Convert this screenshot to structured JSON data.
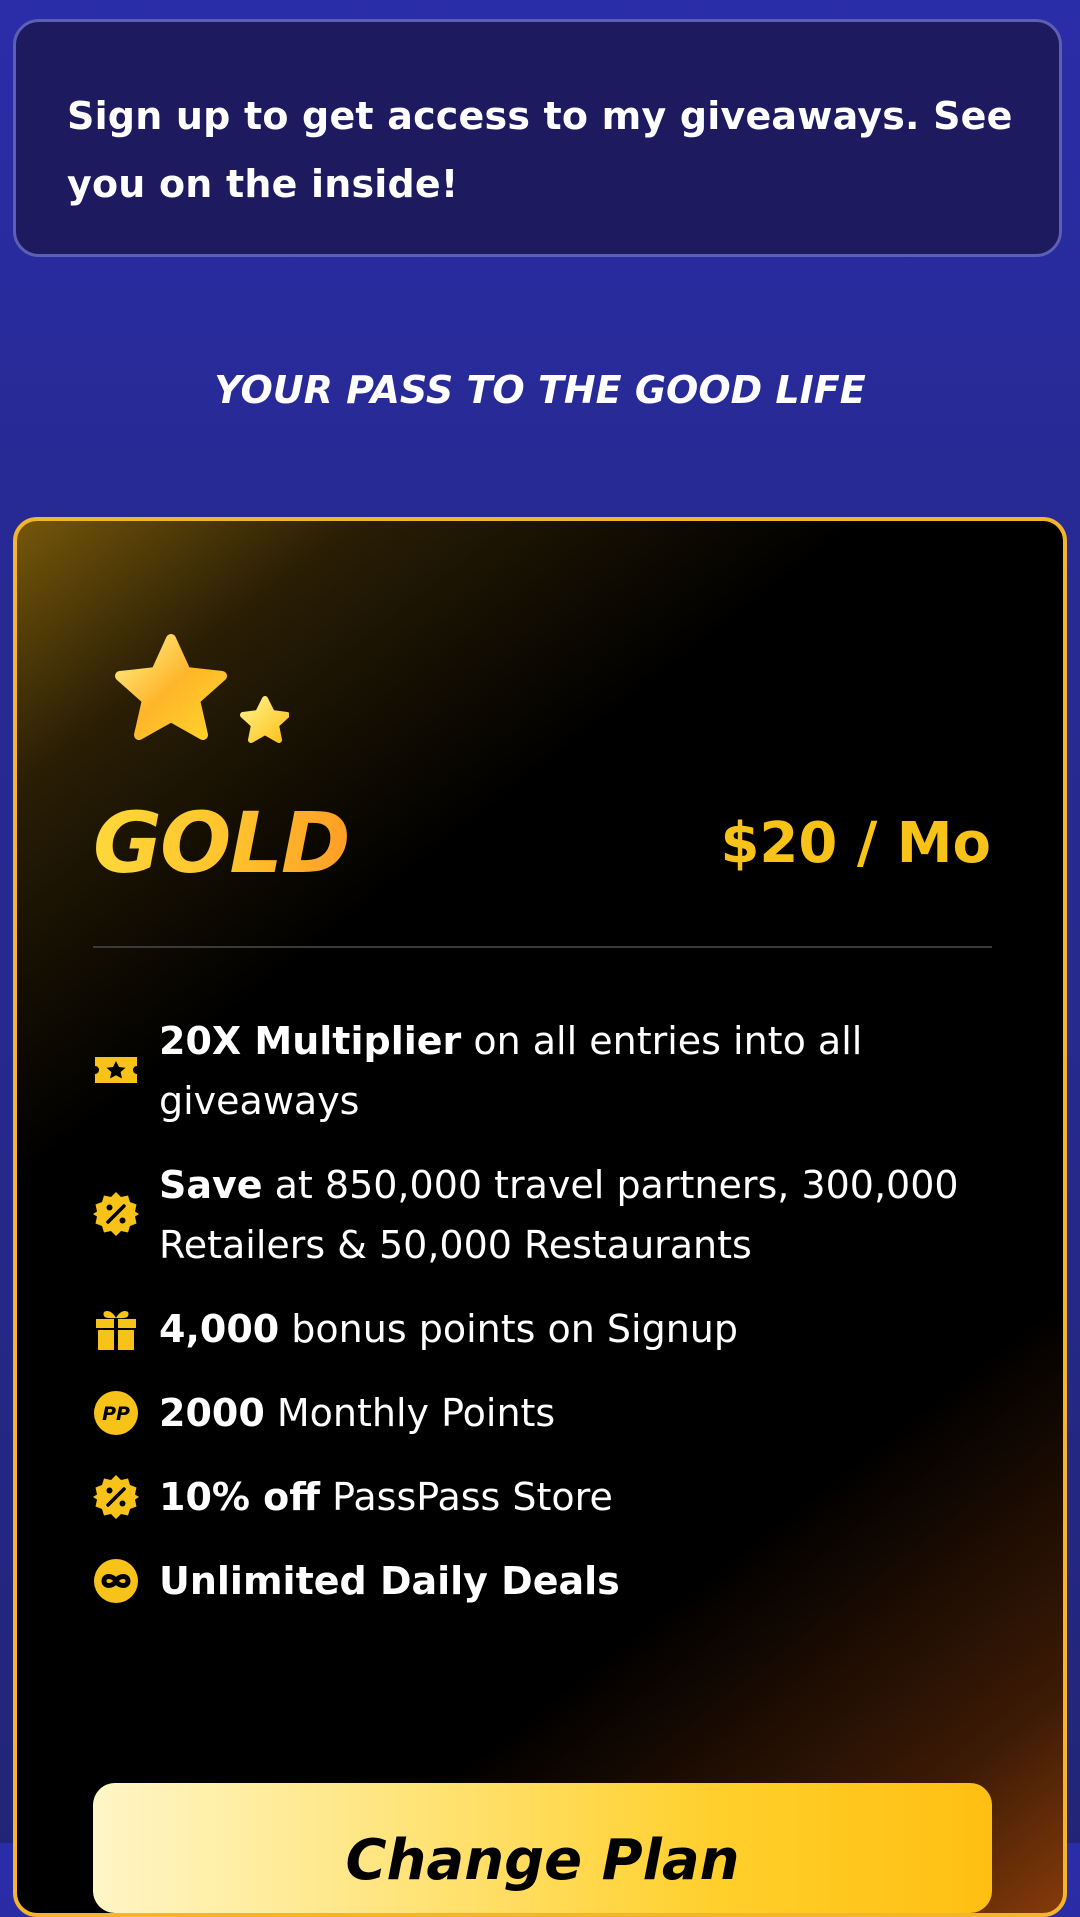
{
  "notice": {
    "text": "Sign up to get access to my giveaways. See you on the inside!"
  },
  "tagline": "YOUR PASS TO THE GOOD LIFE",
  "plan": {
    "name": "GOLD",
    "price": "$20 / Mo",
    "icon": "two-stars-icon",
    "accent_color": "#f8c318",
    "border_color": "#f5b52a",
    "features": [
      {
        "icon": "ticket-star-icon",
        "bold": "20X Multiplier",
        "rest": " on all entries into all giveaways"
      },
      {
        "icon": "discount-badge-icon",
        "bold": "Save",
        "rest": " at 850,000 travel partners, 300,000 Retailers & 50,000 Restaurants"
      },
      {
        "icon": "gift-icon",
        "bold": "4,000",
        "rest": " bonus points on Signup"
      },
      {
        "icon": "points-coin-icon",
        "bold": "2000",
        "rest": " Monthly Points"
      },
      {
        "icon": "discount-badge-icon",
        "bold": "10% off",
        "rest": " PassPass Store"
      },
      {
        "icon": "infinity-icon",
        "bold": "Unlimited Daily Deals",
        "rest": ""
      }
    ],
    "cta_label": "Change Plan"
  },
  "colors": {
    "page_background": "#26298c",
    "notice_background": "#1d1a5f",
    "notice_border": "#5c5fb3",
    "card_background": "#000000"
  }
}
